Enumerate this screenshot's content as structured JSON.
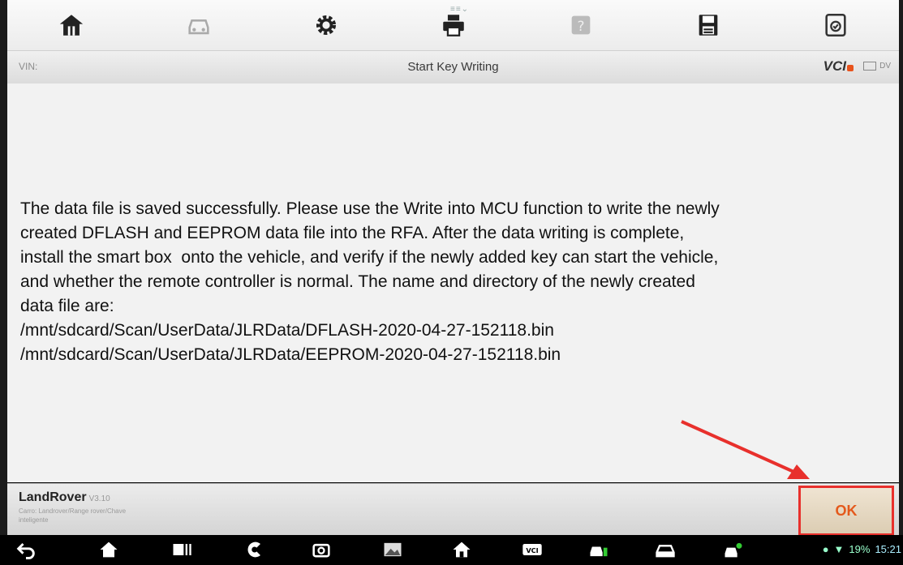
{
  "toolbar": {
    "handle_text": "≡≡⌄",
    "buttons": [
      "home-icon",
      "vehicle-icon",
      "settings-icon",
      "print-icon",
      "help-icon",
      "save-icon",
      "report-icon"
    ]
  },
  "titlebar": {
    "vin_label": "VIN:",
    "title": "Start Key Writing",
    "vci_logo": "VCI",
    "battery_label": "DV"
  },
  "content": {
    "message": "The data file is saved successfully. Please use the Write into MCU function to write the newly\ncreated DFLASH and EEPROM data file into the RFA. After the data writing is complete,\ninstall the smart box  onto the vehicle, and verify if the newly added key can start the vehicle,\nand whether the remote controller is normal. The name and directory of the newly created\ndata file are:\n/mnt/sdcard/Scan/UserData/JLRData/DFLASH-2020-04-27-152118.bin\n/mnt/sdcard/Scan/UserData/JLRData/EEPROM-2020-04-27-152118.bin"
  },
  "footer": {
    "brand": "LandRover",
    "version": "V3.10",
    "path": "Carro: Landrover/Range rover/Chave\ninteligente",
    "ok_label": "OK",
    "ok_color": "#e4591b",
    "highlight_color": "#e8302c"
  },
  "navbar": {
    "icons": [
      "back-icon",
      "home-nav-icon",
      "recent-apps-icon",
      "app-icon",
      "camera-icon",
      "gallery-icon",
      "diag-home-icon",
      "vci-icon",
      "car-fuel-icon",
      "car-icon",
      "car-user-icon"
    ],
    "status_text": "19%",
    "time": "15:21"
  }
}
